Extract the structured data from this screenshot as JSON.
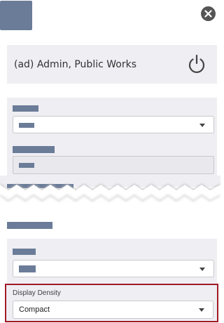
{
  "header": {
    "logo_icon": "app-logo",
    "close_icon": "close-circle-icon"
  },
  "user_card": {
    "name": "(ad) Admin, Public Works",
    "logout_icon": "power-icon"
  },
  "settings": {
    "display_density": {
      "label": "Display Density",
      "value": "Compact"
    }
  },
  "colors": {
    "accent_border": "#a11a24",
    "redaction": "#6b7c98",
    "panel_bg": "#eeeef3"
  }
}
